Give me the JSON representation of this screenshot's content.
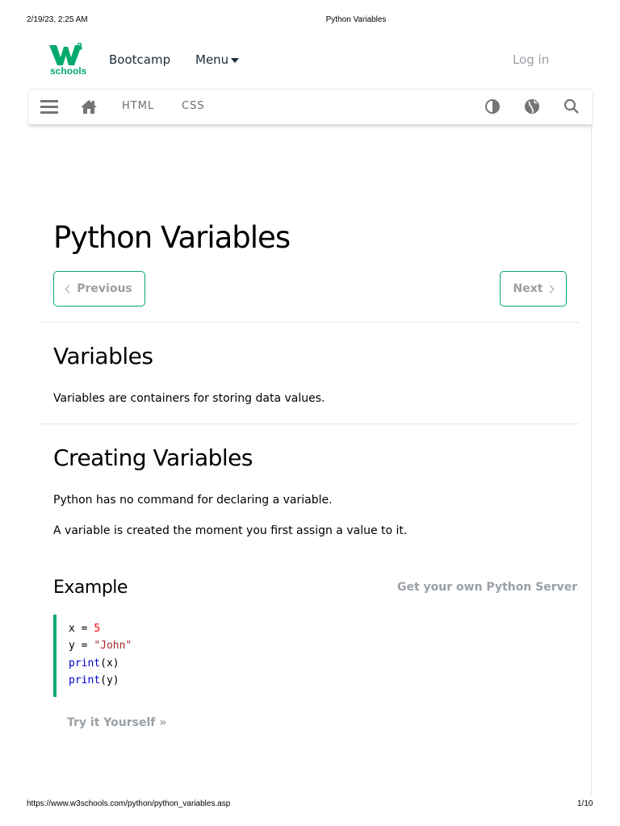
{
  "print": {
    "date": "2/19/23, 2:25 AM",
    "title": "Python Variables",
    "url": "https://www.w3schools.com/python/python_variables.asp",
    "page": "1/10"
  },
  "topbar": {
    "logo_mark": "3",
    "logo_text": "schools",
    "bootcamp": "Bootcamp",
    "menu": "Menu",
    "login": "Log in"
  },
  "subnav": {
    "items": [
      "HTML",
      "CSS"
    ],
    "icons": [
      "menu-icon",
      "home-icon",
      "contrast-icon",
      "globe-icon",
      "search-icon"
    ]
  },
  "main": {
    "title": "Python Variables",
    "prev": "Previous",
    "next": "Next",
    "sections": [
      {
        "heading": "Variables",
        "paragraphs": [
          "Variables are containers for storing data values."
        ]
      },
      {
        "heading": "Creating Variables",
        "paragraphs": [
          "Python has no command for declaring a variable.",
          "A variable is created the moment you first assign a value to it."
        ]
      }
    ],
    "example": {
      "title": "Example",
      "server_link": "Get your own Python Server",
      "code": [
        {
          "text": "x = ",
          "value": "5"
        },
        {
          "text": "y = ",
          "value": "\"John\""
        },
        {
          "fn": "print",
          "arg": "(x)"
        },
        {
          "fn": "print",
          "arg": "(y)"
        }
      ],
      "try_label": "Try it Yourself »"
    }
  },
  "colors": {
    "brand": "#04aa6d",
    "number": "#ff0000",
    "string": "#a52a2a",
    "keyword": "#0000cd",
    "muted": "#9aa0a6"
  }
}
